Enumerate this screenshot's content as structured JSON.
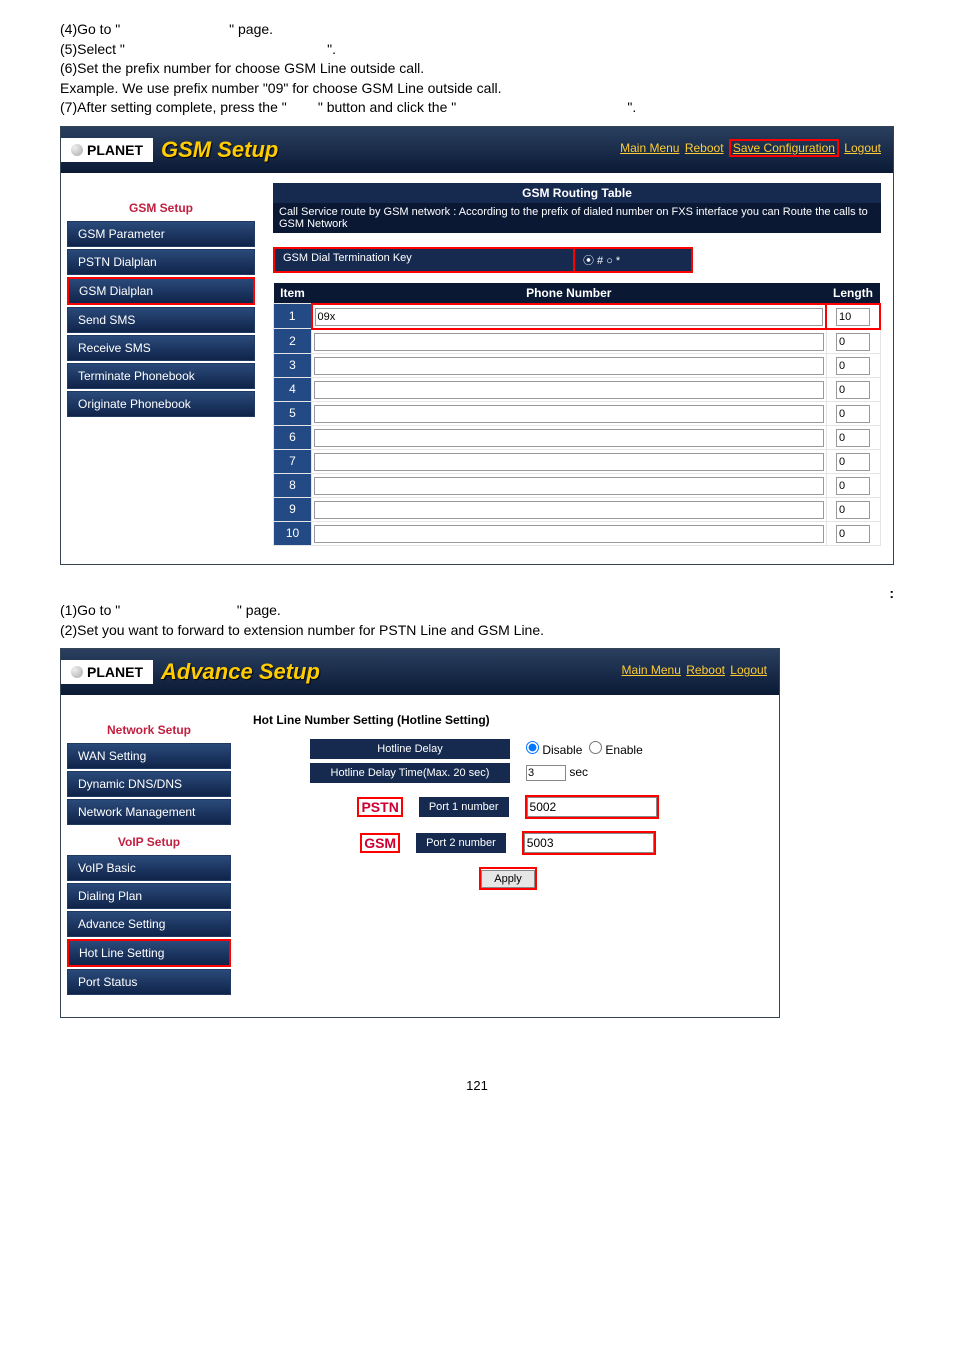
{
  "instr1": {
    "l1a": "(4)Go to \"",
    "l1b": "\" page.",
    "l2a": "(5)Select \"",
    "l2b": "\".",
    "l3": "(6)Set the prefix number for choose GSM Line outside call.",
    "l4": "Example. We use prefix number \"09\" for choose GSM Line outside call.",
    "l5a": "(7)After setting complete, press the \"",
    "l5b": "\" button and click the \"",
    "l5c": "\"."
  },
  "gsm": {
    "logo": "PLANET",
    "title": "GSM Setup",
    "links": {
      "main": "Main Menu",
      "reboot": "Reboot",
      "save": "Save Configuration",
      "logout": "Logout"
    },
    "sidebar_title": "GSM Setup",
    "sidebar": [
      "GSM Parameter",
      "PSTN Dialplan",
      "GSM Dialplan",
      "Send SMS",
      "Receive SMS",
      "Terminate Phonebook",
      "Originate Phonebook"
    ],
    "panel_title": "GSM Routing Table",
    "panel_sub": "Call Service route by GSM network : According to the prefix of dialed number on FXS interface you can Route the calls to GSM Network",
    "key_label": "GSM Dial Termination Key",
    "key_value": "⦿ # ○ *",
    "th_item": "Item",
    "th_phone": "Phone Number",
    "th_len": "Length",
    "rows": [
      {
        "i": "1",
        "phone": "09x",
        "len": "10"
      },
      {
        "i": "2",
        "phone": "",
        "len": "0"
      },
      {
        "i": "3",
        "phone": "",
        "len": "0"
      },
      {
        "i": "4",
        "phone": "",
        "len": "0"
      },
      {
        "i": "5",
        "phone": "",
        "len": "0"
      },
      {
        "i": "6",
        "phone": "",
        "len": "0"
      },
      {
        "i": "7",
        "phone": "",
        "len": "0"
      },
      {
        "i": "8",
        "phone": "",
        "len": "0"
      },
      {
        "i": "9",
        "phone": "",
        "len": "0"
      },
      {
        "i": "10",
        "phone": "",
        "len": "0"
      }
    ]
  },
  "instr2": {
    "colon": ":",
    "l1a": "(1)Go to \"",
    "l1b": "\" page.",
    "l2": "(2)Set you want to forward to extension number for PSTN Line and GSM Line."
  },
  "adv": {
    "logo": "PLANET",
    "title": "Advance Setup",
    "links": {
      "main": "Main Menu",
      "reboot": "Reboot",
      "logout": "Logout"
    },
    "sidebar_title1": "Network Setup",
    "sidebar1": [
      "WAN Setting",
      "Dynamic DNS/DNS",
      "Network Management"
    ],
    "sidebar_title2": "VoIP Setup",
    "sidebar2": [
      "VoIP Basic",
      "Dialing Plan",
      "Advance Setting",
      "Hot Line Setting",
      "Port Status"
    ],
    "section": "Hot Line Number Setting (Hotline Setting)",
    "hotdelay_lbl": "Hotline Delay",
    "hotdelay_opts": {
      "disable": "Disable",
      "enable": "Enable"
    },
    "hotdelaytime_lbl": "Hotline Delay Time(Max. 20 sec)",
    "hotdelaytime_val": "3",
    "sec": "sec",
    "pstn": "PSTN",
    "gsm": "GSM",
    "port1_lbl": "Port 1 number",
    "port1_val": "5002",
    "port2_lbl": "Port 2 number",
    "port2_val": "5003",
    "apply": "Apply"
  },
  "pagenum": "121"
}
